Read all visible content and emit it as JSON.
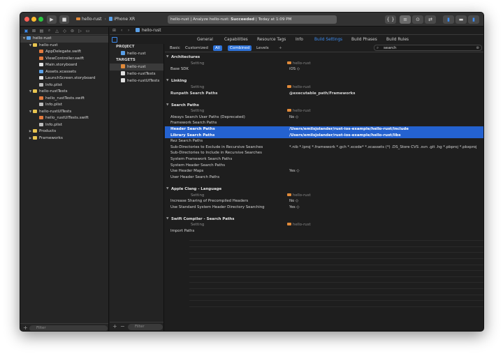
{
  "toolbar": {
    "scheme_target": "hello-rust",
    "scheme_device": "iPhone XR",
    "activity_prefix": "hello-rust | Analyze hello-rust: ",
    "activity_status": "Succeeded",
    "activity_time": " | Today at 1:09 PM",
    "run_icon": "play-icon",
    "stop_icon": "stop-icon"
  },
  "navigator": {
    "tree": [
      {
        "label": "hello-rust",
        "depth": 0,
        "icon": "proj",
        "disclosure": "open",
        "selected": true
      },
      {
        "label": "hello-rust",
        "depth": 1,
        "icon": "folder",
        "disclosure": "open"
      },
      {
        "label": "AppDelegate.swift",
        "depth": 2,
        "icon": "file-swift"
      },
      {
        "label": "ViewController.swift",
        "depth": 2,
        "icon": "file-swift"
      },
      {
        "label": "Main.storyboard",
        "depth": 2,
        "icon": "file-sb"
      },
      {
        "label": "Assets.xcassets",
        "depth": 2,
        "icon": "file-xc"
      },
      {
        "label": "LaunchScreen.storyboard",
        "depth": 2,
        "icon": "file-sb"
      },
      {
        "label": "Info.plist",
        "depth": 2,
        "icon": "file-pl"
      },
      {
        "label": "hello-rustTests",
        "depth": 1,
        "icon": "folder",
        "disclosure": "open"
      },
      {
        "label": "hello_rustTests.swift",
        "depth": 2,
        "icon": "file-swift"
      },
      {
        "label": "Info.plist",
        "depth": 2,
        "icon": "file-pl"
      },
      {
        "label": "hello-rustUITests",
        "depth": 1,
        "icon": "folder",
        "disclosure": "open"
      },
      {
        "label": "hello_rustUITests.swift",
        "depth": 2,
        "icon": "file-swift"
      },
      {
        "label": "Info.plist",
        "depth": 2,
        "icon": "file-pl"
      },
      {
        "label": "Products",
        "depth": 1,
        "icon": "folder",
        "disclosure": "closed"
      },
      {
        "label": "Frameworks",
        "depth": 1,
        "icon": "folder",
        "disclosure": "closed"
      }
    ],
    "filter_placeholder": "Filter"
  },
  "editor": {
    "jump_project": "hello-rust",
    "tabs": [
      "General",
      "Capabilities",
      "Resource Tags",
      "Info",
      "Build Settings",
      "Build Phases",
      "Build Rules"
    ],
    "active_tab": "Build Settings",
    "project_header": "PROJECT",
    "project_item": "hello-rust",
    "targets_header": "TARGETS",
    "targets": [
      "hello-rust",
      "hello-rustTests",
      "hello-rustUITests"
    ],
    "filter_placeholder": "Filter"
  },
  "build_settings": {
    "scope_basic": "Basic",
    "scope_customized": "Customized",
    "scope_all": "All",
    "view_combined": "Combined",
    "view_levels": "Levels",
    "add_label": "+",
    "search_value": "search",
    "sections": [
      {
        "title": "Architectures",
        "col_setting": "Setting",
        "col_target": "hello-rust",
        "rows": [
          {
            "name": "Base SDK",
            "value": "iOS ◇"
          }
        ]
      },
      {
        "title": "Linking",
        "col_setting": "Setting",
        "col_target": "hello-rust",
        "rows": [
          {
            "name": "Runpath Search Paths",
            "value": "@executable_path/Frameworks",
            "bold": true
          }
        ]
      },
      {
        "title": "Search Paths",
        "col_setting": "Setting",
        "col_target": "hello-rust",
        "rows": [
          {
            "name": "Always Search User Paths (Deprecated)",
            "value": "No ◇"
          },
          {
            "name": "Framework Search Paths",
            "value": ""
          },
          {
            "name": "Header Search Paths",
            "value": "/Users/emilsjolander/rust-ios-example/hello-rust/include",
            "selected": true
          },
          {
            "name": "Library Search Paths",
            "value": "/Users/emilsjolander/rust-ios-example/hello-rust/libs",
            "selected": true
          },
          {
            "name": "Rez Search Paths",
            "value": ""
          },
          {
            "name": "Sub-Directories to Exclude in Recursive Searches",
            "value": "*.nib *.lproj *.framework *.gch *.xcode* *.xcassets (*) .DS_Store CVS .svn .git .hg *.pbproj *.pbxproj"
          },
          {
            "name": "Sub-Directories to Include in Recursive Searches",
            "value": ""
          },
          {
            "name": "System Framework Search Paths",
            "value": ""
          },
          {
            "name": "System Header Search Paths",
            "value": ""
          },
          {
            "name": "Use Header Maps",
            "value": "Yes ◇"
          },
          {
            "name": "User Header Search Paths",
            "value": ""
          }
        ]
      },
      {
        "title": "Apple Clang - Language",
        "col_setting": "Setting",
        "col_target": "hello-rust",
        "rows": [
          {
            "name": "Increase Sharing of Precompiled Headers",
            "value": "No ◇"
          },
          {
            "name": "Use Standard System Header Directory Searching",
            "value": "Yes ◇"
          }
        ]
      },
      {
        "title": "Swift Compiler - Search Paths",
        "col_setting": "Setting",
        "col_target": "hello-rust",
        "rows": [
          {
            "name": "Import Paths",
            "value": ""
          }
        ]
      }
    ]
  },
  "colors": {
    "accent": "#2d72d9",
    "selection": "#2462d0",
    "background": "#1e1e1e"
  }
}
